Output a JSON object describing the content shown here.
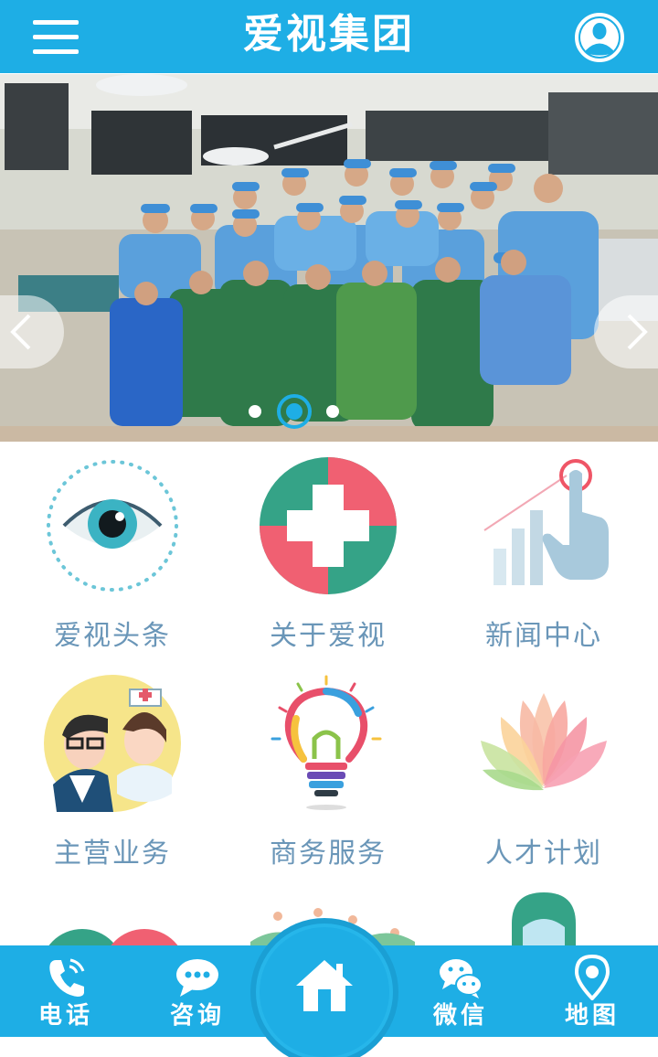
{
  "header": {
    "title": "爱视集团",
    "menu_icon": "hamburger-menu-icon",
    "user_icon": "user-profile-icon",
    "color": "#1eaee5"
  },
  "banner": {
    "slide_count": 3,
    "active_slide": 2,
    "left_arrow_icon": "chevron-left-icon",
    "right_arrow_icon": "chevron-right-icon"
  },
  "grid": [
    {
      "label": "爱视头条",
      "icon": "eye-icon"
    },
    {
      "label": "关于爱视",
      "icon": "medical-cross-icon"
    },
    {
      "label": "新闻中心",
      "icon": "chart-pointer-icon"
    },
    {
      "label": "主营业务",
      "icon": "doctor-nurse-icon"
    },
    {
      "label": "商务服务",
      "icon": "lightbulb-icon"
    },
    {
      "label": "人才计划",
      "icon": "lotus-icon"
    }
  ],
  "bottom_nav": {
    "phone": {
      "label": "电话",
      "icon": "phone-icon"
    },
    "consult": {
      "label": "咨询",
      "icon": "chat-bubble-icon"
    },
    "home": {
      "icon": "home-icon"
    },
    "wechat": {
      "label": "微信",
      "icon": "wechat-icon"
    },
    "map": {
      "label": "地图",
      "icon": "map-pin-icon"
    }
  }
}
